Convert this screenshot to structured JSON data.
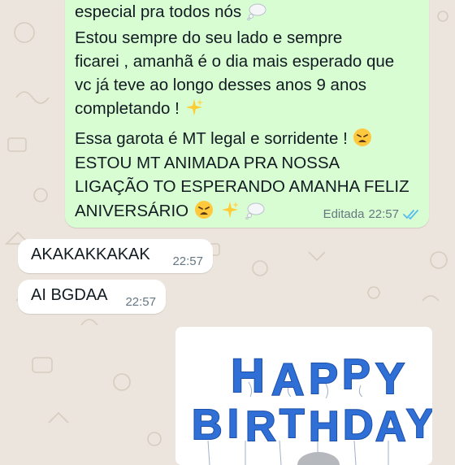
{
  "chat": {
    "outgoing": {
      "lines": [
        "especial pra todos nós",
        "Estou sempre do seu lado e sempre",
        "ficarei , amanhã é o dia mais esperado que",
        "vc já teve ao longo desses anos 9 anos",
        "completando !",
        "Essa garota é MT legal e sorridente !",
        "ESTOU MT ANIMADA PRA NOSSA",
        "LIGAÇÃO TO ESPERANDO AMANHA FELIZ",
        "ANIVERSÁRIO"
      ],
      "edited_label": "Editada",
      "time": "22:57",
      "status": "read",
      "status_color": "#53bdeb"
    },
    "incoming": [
      {
        "text": "AKAKAKKAKAK",
        "time": "22:57"
      },
      {
        "text": "AI BGDAA",
        "time": "22:57"
      }
    ],
    "image_message": {
      "caption_art": "HAPPY BIRTHDAY",
      "balloon_color": "#2f6fd6"
    }
  },
  "icons": [
    "thought-balloon-emoji",
    "sparkles-emoji",
    "weary-face-emoji",
    "double-check-icon"
  ],
  "colors": {
    "background": "#ece5dd",
    "outgoing_bubble": "#d9fdd3",
    "incoming_bubble": "#ffffff"
  }
}
